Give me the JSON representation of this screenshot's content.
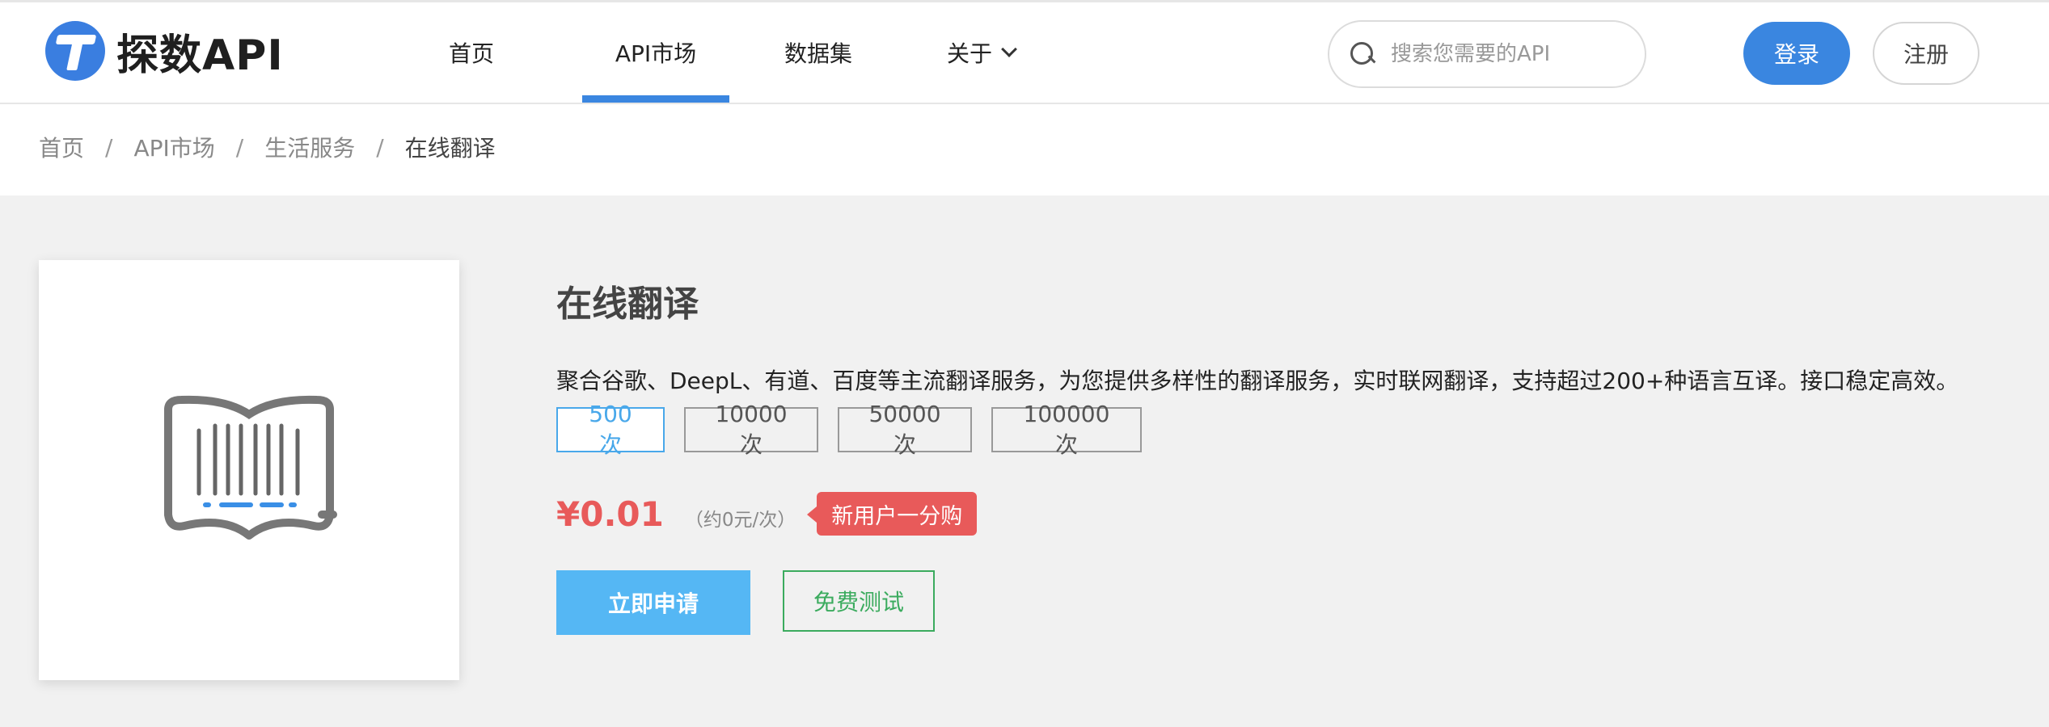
{
  "header": {
    "logo_text": "探数API",
    "nav": [
      {
        "label": "首页",
        "active": false
      },
      {
        "label": "API市场",
        "active": true
      },
      {
        "label": "数据集",
        "active": false
      },
      {
        "label": "关于",
        "active": false,
        "has_dropdown": true
      }
    ],
    "search": {
      "placeholder": "搜索您需要的API",
      "value": ""
    },
    "login_label": "登录",
    "register_label": "注册"
  },
  "breadcrumb": [
    "首页",
    "API市场",
    "生活服务",
    "在线翻译"
  ],
  "breadcrumb_separator": "/",
  "product": {
    "icon": "book-barcode-icon",
    "title": "在线翻译",
    "description": "聚合谷歌、DeepL、有道、百度等主流翻译服务，为您提供多样性的翻译服务，实时联网翻译，支持超过200+种语言互译。接口稳定高效。",
    "options": [
      {
        "label": "500次",
        "selected": true
      },
      {
        "label": "10000次",
        "selected": false
      },
      {
        "label": "50000次",
        "selected": false
      },
      {
        "label": "100000次",
        "selected": false
      }
    ],
    "price": "¥0.01",
    "unit_price": "（约0元/次）",
    "promo_badge": "新用户一分购",
    "apply_label": "立即申请",
    "test_label": "免费测试"
  },
  "colors": {
    "accent": "#3a86e0",
    "price": "#e85a5a",
    "apply": "#55b7f4",
    "test": "#3bab5e"
  }
}
